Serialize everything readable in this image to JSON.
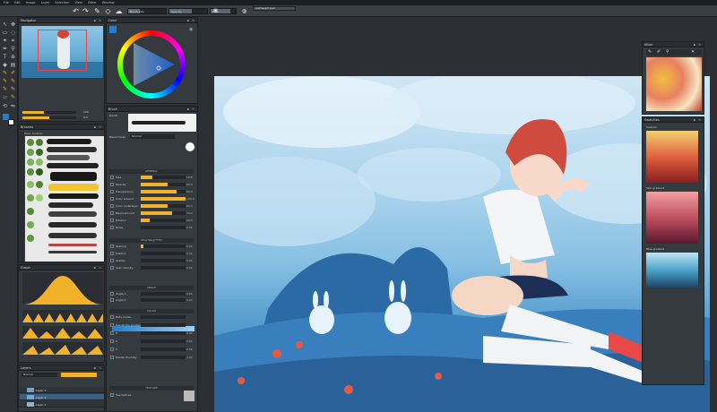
{
  "menu": [
    "File",
    "Edit",
    "Image",
    "Layer",
    "Selection",
    "View",
    "Other",
    "Window"
  ],
  "toolbar": {
    "brush_size_label": "Brush size",
    "opacity_label": "Opacity",
    "flow_label": "Flow",
    "tab_name": "anime-girl.psd"
  },
  "panels": {
    "navigator": {
      "title": "Navigator",
      "zoom": "100",
      "rotation": "0.0"
    },
    "brushes": {
      "title": "Brushes",
      "category": "Basic brushes"
    },
    "graph": {
      "title": "Graph",
      "pressure_label": "Pressure"
    },
    "layers": {
      "title": "Layers",
      "blend_mode": "Normal",
      "opacity": "100",
      "items": [
        "Layer 3",
        "Layer 2",
        "Layer 1"
      ]
    },
    "color": {
      "title": "Color"
    },
    "brush": {
      "title": "Brush",
      "name_label": "Brush",
      "blend_label": "Blend mode",
      "blend_value": "Normal",
      "general_header": "GENERAL",
      "spacing_header": "SPACING/JITTER",
      "angle_header": "ANGLE",
      "color_header": "COLOR",
      "texture_header": "TEXTURE",
      "rows": [
        {
          "label": "Size",
          "value": "18.8",
          "fill": 0.25
        },
        {
          "label": "Opacity",
          "value": "60.0",
          "fill": 0.6
        },
        {
          "label": "Transparency",
          "value": "80.0",
          "fill": 0.8
        },
        {
          "label": "Color amount",
          "value": "100.0",
          "fill": 1.0
        },
        {
          "label": "Color underlayer",
          "value": "60.0",
          "fill": 0.6
        },
        {
          "label": "Blend amount",
          "value": "70.0",
          "fill": 0.7
        },
        {
          "label": "Dilution",
          "value": "20.0",
          "fill": 0.2
        },
        {
          "label": "Noise",
          "value": "0.00",
          "fill": 0.0
        }
      ],
      "spacing_rows": [
        {
          "label": "Spacing",
          "value": "0.00",
          "fill": 0.05
        },
        {
          "label": "Position",
          "value": "0.00",
          "fill": 0.0
        },
        {
          "label": "Scatter",
          "value": "0.00",
          "fill": 0.0
        },
        {
          "label": "Scat. density",
          "value": "0.00",
          "fill": 0.0
        }
      ],
      "angle_rows": [
        {
          "label": "Angle 1",
          "value": "0.00",
          "fill": 0.0
        },
        {
          "label": "Angle 2",
          "value": "0.00",
          "fill": 0.0
        }
      ],
      "color_rows": [
        {
          "label": "Dirty mode",
          "value": "",
          "fill": 0.0
        },
        {
          "label": "Use stroke gradient",
          "value": "",
          "fill": 0.0
        },
        {
          "label": "H",
          "value": "0.00",
          "fill": 0.0
        },
        {
          "label": "S",
          "value": "0.00",
          "fill": 0.0
        },
        {
          "label": "V",
          "value": "0.00",
          "fill": 0.0
        },
        {
          "label": "Bristle diversity",
          "value": "0.00",
          "fill": 0.0
        }
      ],
      "texture_label": "Use texture"
    },
    "mixer": {
      "title": "Mixer"
    },
    "swatches": {
      "title": "Swatches",
      "group1": "Custom",
      "group2": "Skin gradient",
      "group3": "Blue gradient"
    }
  },
  "colors": {
    "accent": "#f1b12b",
    "primary": "#1e7fd0",
    "secondary": "#ffffff"
  }
}
